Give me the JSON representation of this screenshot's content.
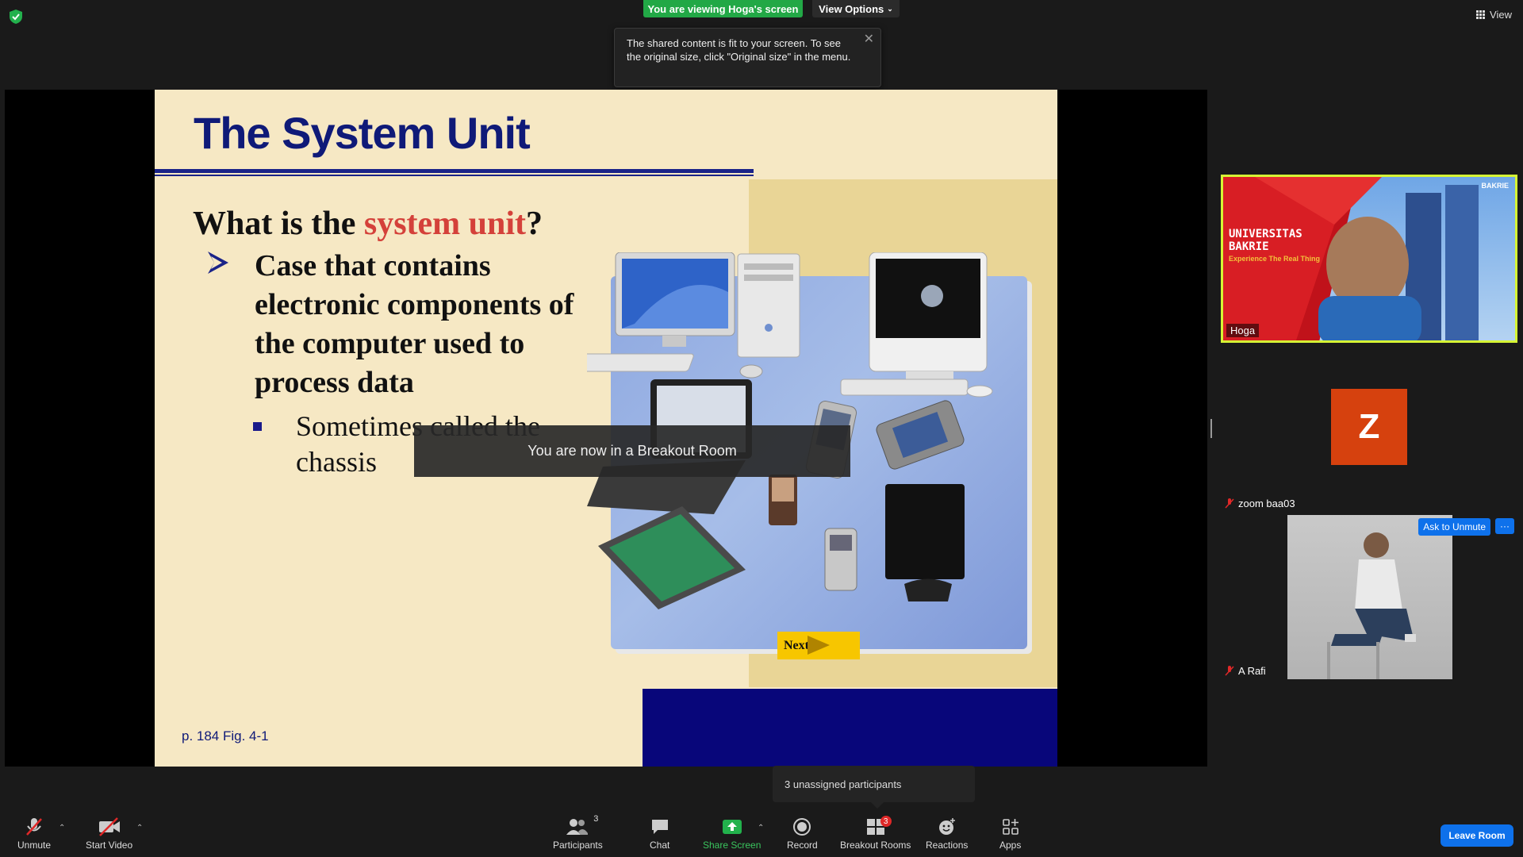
{
  "top": {
    "viewing_banner": "You are viewing Hoga's screen",
    "view_options": "View Options",
    "view_label": "View"
  },
  "tooltip": {
    "text": "The shared content is fit to your screen. To see the original size, click \"Original size\" in the menu."
  },
  "slide": {
    "title": "The System Unit",
    "question_prefix": "What is the ",
    "question_highlight": "system unit",
    "question_suffix": "?",
    "bullet": "Case that contains electronic components of the computer used to process data",
    "sub_bullet": "Sometimes called the chassis",
    "reference": "p. 184 Fig. 4-1",
    "next_label": "Next",
    "colors": {
      "title": "#0f1a78",
      "highlight": "#d4413a",
      "background": "#f6e8c4",
      "footer": "#08067a",
      "next": "#f7c600"
    }
  },
  "breakout_toast": "You are now in a Breakout Room",
  "participants_panel": {
    "tiles": [
      {
        "name": "Hoga",
        "brand_line1": "UNIVERSITAS",
        "brand_line2": "BAKRIE",
        "tagline": "Experience The Real Thing",
        "logo_text": "BAKRIE"
      },
      {
        "name": "zoom baa03",
        "avatar_letter": "Z",
        "muted": true
      },
      {
        "name": "A Rafi",
        "muted": true,
        "ask_unmute": "Ask to Unmute",
        "more": "···"
      }
    ]
  },
  "unassigned_popup": "3 unassigned participants",
  "toolbar": {
    "unmute": "Unmute",
    "start_video": "Start Video",
    "participants": "Participants",
    "participants_count": "3",
    "chat": "Chat",
    "share_screen": "Share Screen",
    "record": "Record",
    "breakout_rooms": "Breakout Rooms",
    "breakout_badge": "3",
    "reactions": "Reactions",
    "apps": "Apps",
    "leave": "Leave Room"
  }
}
